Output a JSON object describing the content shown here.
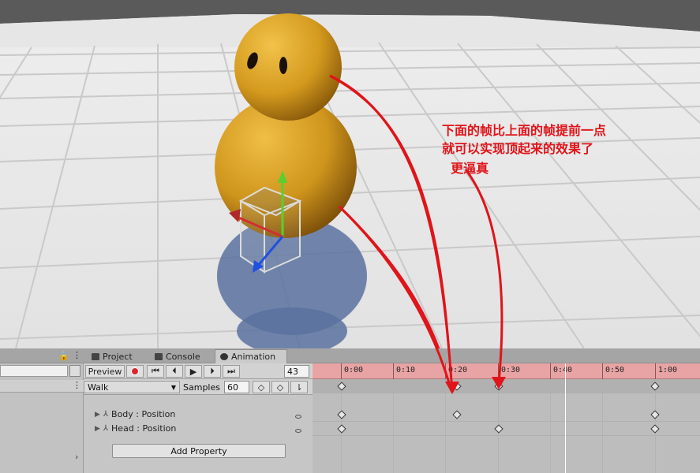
{
  "annotation": {
    "line1": "下面的帧比上面的帧提前一点",
    "line2": "就可以实现顶起来的效果了",
    "line3": "  更逼真"
  },
  "tabs": [
    {
      "label": "Project",
      "icon": "folder-icon"
    },
    {
      "label": "Console",
      "icon": "console-icon"
    },
    {
      "label": "Animation",
      "icon": "clock-icon",
      "active": true
    }
  ],
  "toolbar": {
    "preview_label": "Preview",
    "frame_value": "43"
  },
  "clip": {
    "name": "Walk",
    "samples_label": "Samples",
    "samples_value": "60"
  },
  "properties": [
    {
      "label": "Body : Position"
    },
    {
      "label": "Head : Position"
    }
  ],
  "add_property_label": "Add Property",
  "ruler_ticks": [
    "0:00",
    "0:10",
    "0:20",
    "0:30",
    "0:40",
    "0:50",
    "1:00"
  ],
  "keyframes": {
    "summary": [
      "0:00",
      "0:18",
      "0:24",
      "1:00"
    ],
    "body": [
      "0:00",
      "0:18",
      "1:00"
    ],
    "head": [
      "0:00",
      "0:24",
      "1:00"
    ]
  },
  "colors": {
    "record_red": "#d8262a",
    "ruler_pink": "#e8a4a4",
    "character_gold": "#d49a1e",
    "annotation_red": "#e0141a"
  }
}
